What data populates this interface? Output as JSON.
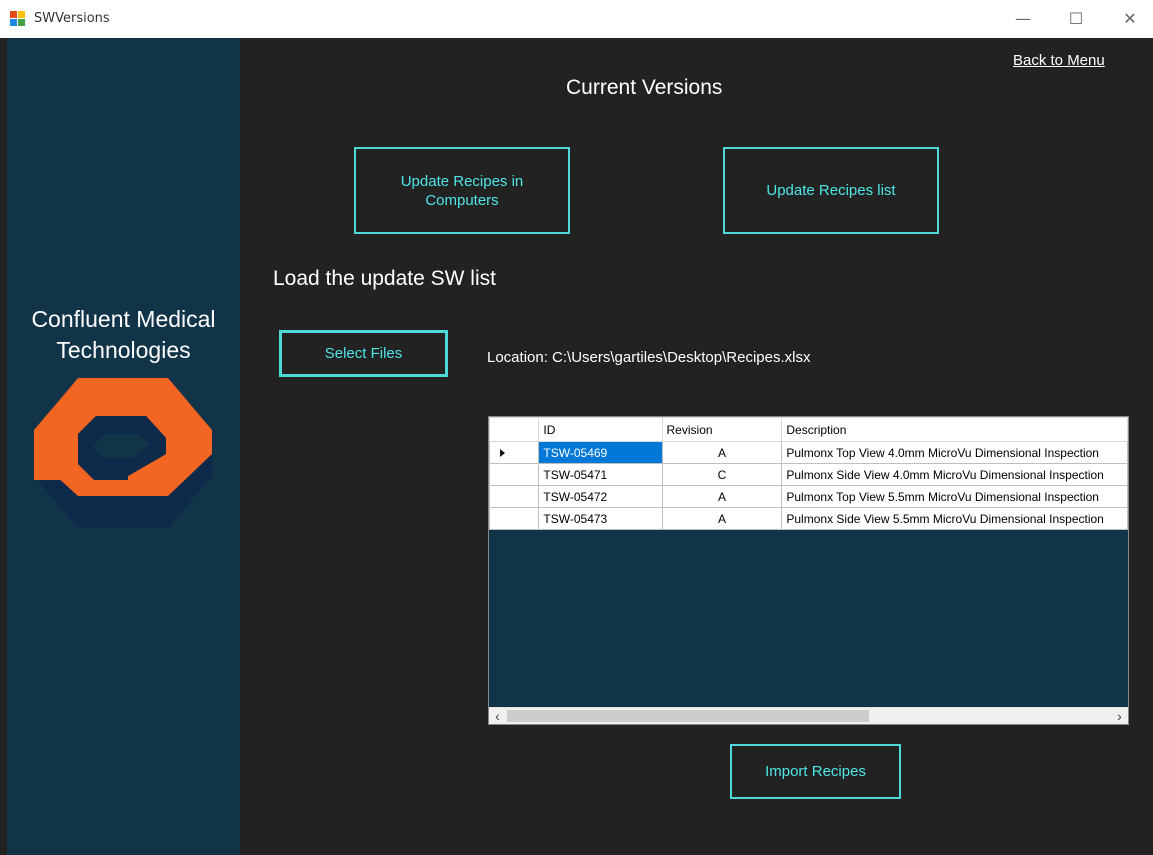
{
  "window": {
    "title": "SWVersions",
    "minimize_glyph": "—",
    "maximize_glyph": "☐",
    "close_glyph": "✕"
  },
  "sidebar": {
    "brand_line1": "Confluent Medical",
    "brand_line2": "Technologies",
    "logo_icon": "hexagon-logo-icon"
  },
  "header": {
    "back_link": "Back to Menu",
    "title": "Current Versions"
  },
  "actions": {
    "update_computers_line1": "Update Recipes in",
    "update_computers_line2": "Computers",
    "update_list": "Update Recipes list",
    "select_files": "Select Files",
    "import": "Import Recipes"
  },
  "load_section": {
    "title": "Load the update SW list",
    "location": "Location: C:\\Users\\gartiles\\Desktop\\Recipes.xlsx"
  },
  "grid": {
    "columns": [
      "ID",
      "Revision",
      "Description"
    ],
    "rows": [
      {
        "id": "TSW-05469",
        "revision": "A",
        "description": "Pulmonx Top View 4.0mm MicroVu Dimensional Inspection"
      },
      {
        "id": "TSW-05471",
        "revision": "C",
        "description": "Pulmonx Side View 4.0mm MicroVu Dimensional Inspection"
      },
      {
        "id": "TSW-05472",
        "revision": "A",
        "description": "Pulmonx Top View 5.5mm MicroVu Dimensional Inspection"
      },
      {
        "id": "TSW-05473",
        "revision": "A",
        "description": "Pulmonx Side View 5.5mm MicroVu Dimensional Inspection"
      }
    ],
    "selected_row": 0,
    "scroll_left_glyph": "‹",
    "scroll_right_glyph": "›"
  },
  "colors": {
    "sidebar_bg": "#123448",
    "main_bg": "#222222",
    "accent_border": "#4fd8d8",
    "logo_orange": "#f26522",
    "logo_navy": "#0d2a4a"
  }
}
